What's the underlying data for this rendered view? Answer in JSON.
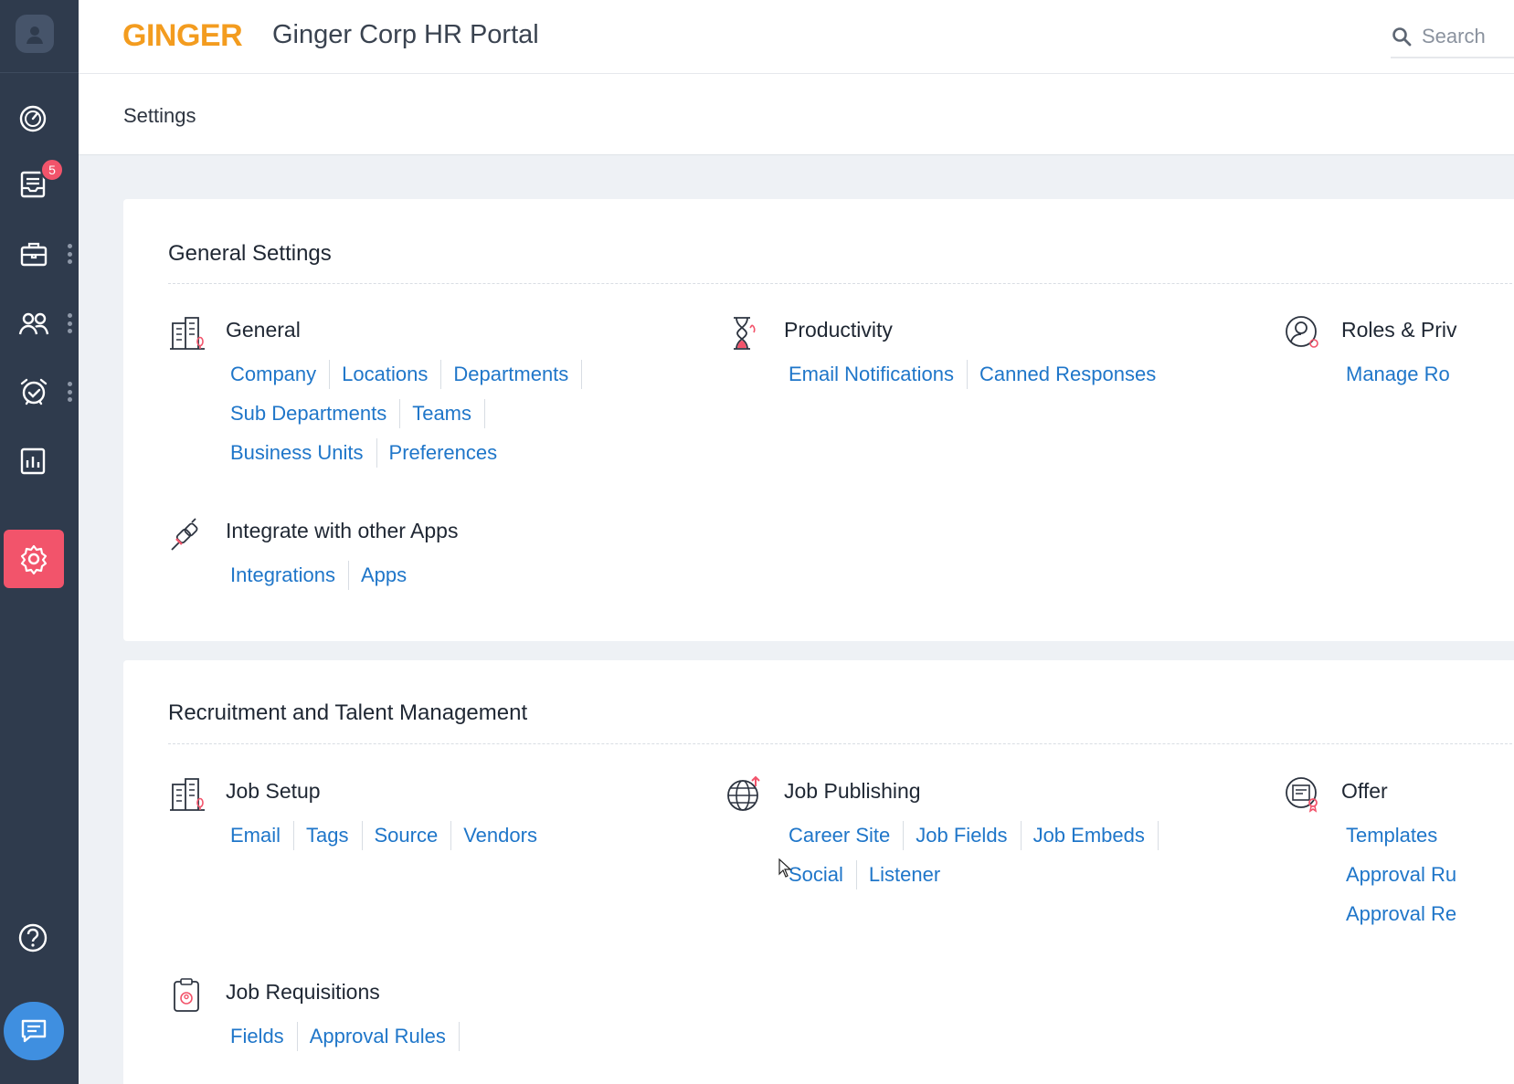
{
  "header": {
    "logo": "GINGER",
    "title": "Ginger Corp HR Portal",
    "search_placeholder": "Search"
  },
  "page": {
    "title": "Settings"
  },
  "sidebar": {
    "badge_count": "5"
  },
  "general": {
    "title": "General Settings",
    "general": {
      "title": "General",
      "links": [
        [
          "Company",
          "Locations",
          "Departments"
        ],
        [
          "Sub Departments",
          "Teams"
        ],
        [
          "Business Units",
          "Preferences"
        ]
      ]
    },
    "productivity": {
      "title": "Productivity",
      "links": [
        [
          "Email Notifications",
          "Canned Responses"
        ]
      ]
    },
    "roles": {
      "title": "Roles & Priv",
      "links": [
        [
          "Manage Ro"
        ]
      ]
    },
    "integrate": {
      "title": "Integrate with other Apps",
      "links": [
        [
          "Integrations",
          "Apps"
        ]
      ]
    }
  },
  "recruitment": {
    "title": "Recruitment and Talent Management",
    "job_setup": {
      "title": "Job Setup",
      "links": [
        [
          "Email",
          "Tags",
          "Source",
          "Vendors"
        ]
      ]
    },
    "job_publishing": {
      "title": "Job Publishing",
      "links": [
        [
          "Career Site",
          "Job Fields",
          "Job Embeds"
        ],
        [
          "Social",
          "Listener"
        ]
      ]
    },
    "offer": {
      "title": "Offer",
      "links": [
        [
          "Templates"
        ],
        [
          "Approval Ru"
        ],
        [
          "Approval Re"
        ]
      ]
    },
    "job_requisitions": {
      "title": "Job Requisitions",
      "links": [
        [
          "Fields",
          "Approval Rules"
        ]
      ]
    }
  },
  "colors": {
    "sidebar": "#2f3b4d",
    "accent": "#f2546b",
    "link": "#1f76c9",
    "logo": "#f39c1f"
  }
}
